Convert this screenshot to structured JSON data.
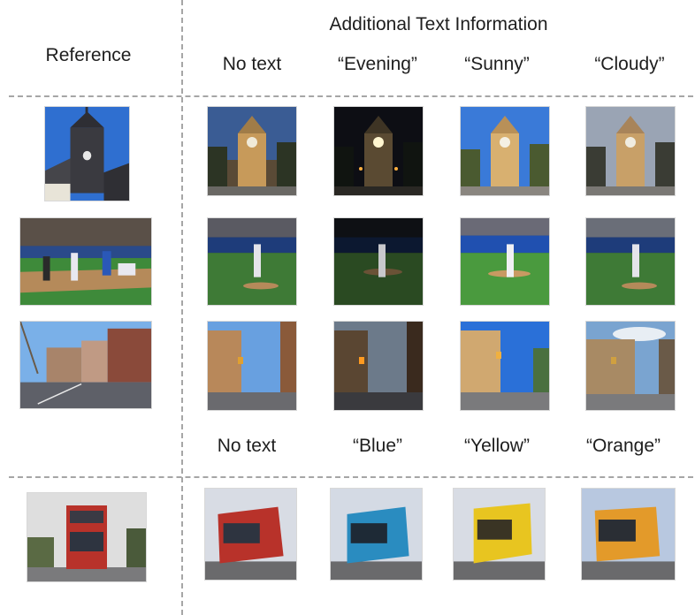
{
  "header": {
    "section_title": "Additional Text Information",
    "reference_label": "Reference",
    "top_columns": [
      "No text",
      "“Evening”",
      "“Sunny”",
      "“Cloudy”"
    ],
    "bottom_columns": [
      "No text",
      "“Blue”",
      "“Yellow”",
      "“Orange”"
    ]
  },
  "rows": [
    {
      "reference": "clock-tower",
      "variants": [
        "tower-no-text",
        "tower-evening",
        "tower-sunny",
        "tower-cloudy"
      ]
    },
    {
      "reference": "baseball-field",
      "variants": [
        "baseball-no-text",
        "baseball-evening",
        "baseball-sunny",
        "baseball-cloudy"
      ]
    },
    {
      "reference": "city-street",
      "variants": [
        "street-no-text",
        "street-evening",
        "street-sunny",
        "street-cloudy"
      ]
    },
    {
      "reference": "red-double-decker-bus",
      "variants": [
        "bus-no-text",
        "bus-blue",
        "bus-yellow",
        "bus-orange"
      ]
    }
  ],
  "colors": {
    "divider": "#a6a6a6",
    "bus_red": "#b8322a",
    "bus_blue": "#2a8cc0",
    "bus_yellow": "#e8c520",
    "bus_orange": "#e39a2a"
  }
}
